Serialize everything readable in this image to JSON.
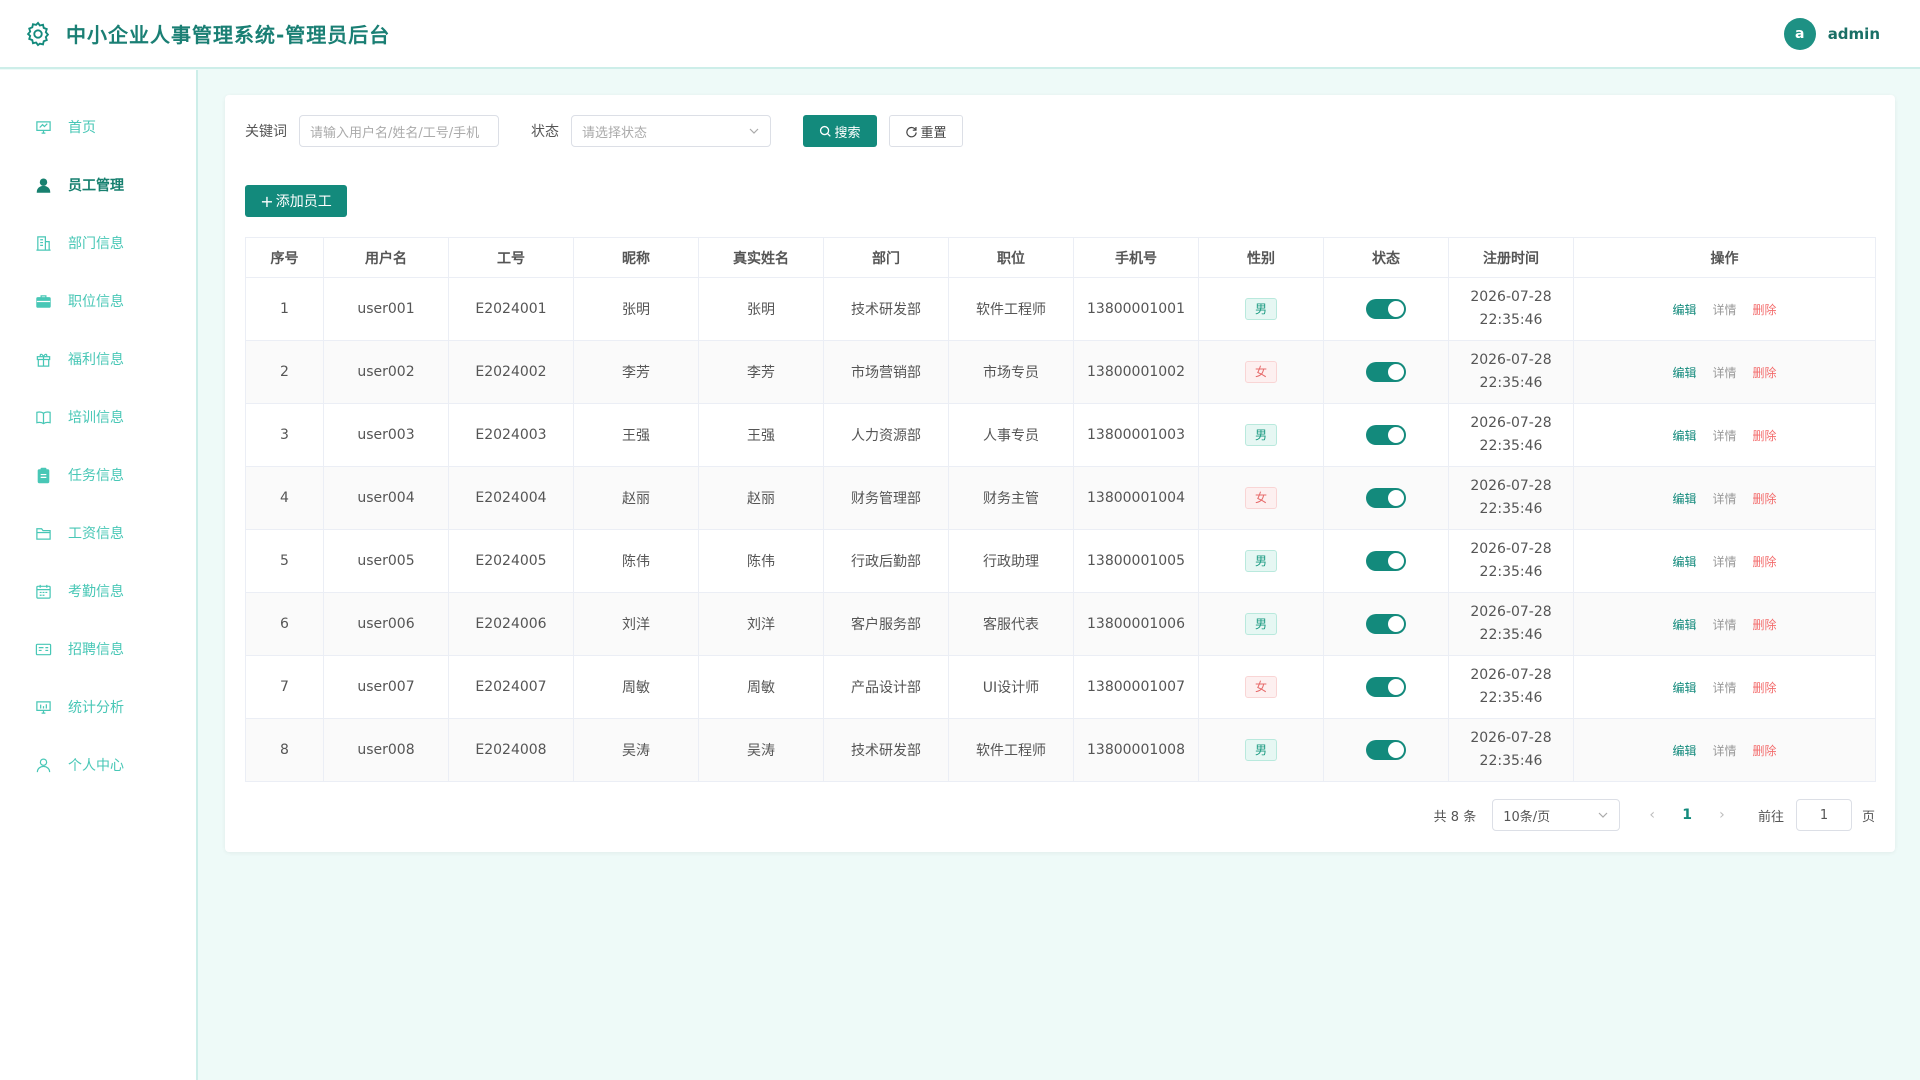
{
  "header": {
    "title": "中小企业人事管理系统-管理员后台",
    "avatar_letter": "a",
    "username": "admin"
  },
  "sidebar": {
    "items": [
      {
        "label": "首页",
        "icon": "dashboard-icon",
        "active": false
      },
      {
        "label": "员工管理",
        "icon": "user-icon",
        "active": true
      },
      {
        "label": "部门信息",
        "icon": "building-icon",
        "active": false
      },
      {
        "label": "职位信息",
        "icon": "briefcase-icon",
        "active": false
      },
      {
        "label": "福利信息",
        "icon": "gift-icon",
        "active": false
      },
      {
        "label": "培训信息",
        "icon": "book-icon",
        "active": false
      },
      {
        "label": "任务信息",
        "icon": "clipboard-icon",
        "active": false
      },
      {
        "label": "工资信息",
        "icon": "folder-icon",
        "active": false
      },
      {
        "label": "考勤信息",
        "icon": "calendar-icon",
        "active": false
      },
      {
        "label": "招聘信息",
        "icon": "id-card-icon",
        "active": false
      },
      {
        "label": "统计分析",
        "icon": "chart-icon",
        "active": false
      },
      {
        "label": "个人中心",
        "icon": "person-icon",
        "active": false
      }
    ]
  },
  "filters": {
    "keyword_label": "关键词",
    "keyword_placeholder": "请输入用户名/姓名/工号/手机",
    "status_label": "状态",
    "status_placeholder": "请选择状态",
    "search_label": "搜索",
    "reset_label": "重置"
  },
  "add_button": "添加员工",
  "table": {
    "columns": [
      "序号",
      "用户名",
      "工号",
      "昵称",
      "真实姓名",
      "部门",
      "职位",
      "手机号",
      "性别",
      "状态",
      "注册时间",
      "操作"
    ],
    "rows": [
      {
        "idx": "1",
        "username": "user001",
        "emp_no": "E2024001",
        "nickname": "张明",
        "realname": "张明",
        "dept": "技术研发部",
        "position": "软件工程师",
        "phone": "13800001001",
        "gender": "男",
        "status_on": true,
        "reg_date": "2026-07-28",
        "reg_time": "22:35:46"
      },
      {
        "idx": "2",
        "username": "user002",
        "emp_no": "E2024002",
        "nickname": "李芳",
        "realname": "李芳",
        "dept": "市场营销部",
        "position": "市场专员",
        "phone": "13800001002",
        "gender": "女",
        "status_on": true,
        "reg_date": "2026-07-28",
        "reg_time": "22:35:46"
      },
      {
        "idx": "3",
        "username": "user003",
        "emp_no": "E2024003",
        "nickname": "王强",
        "realname": "王强",
        "dept": "人力资源部",
        "position": "人事专员",
        "phone": "13800001003",
        "gender": "男",
        "status_on": true,
        "reg_date": "2026-07-28",
        "reg_time": "22:35:46"
      },
      {
        "idx": "4",
        "username": "user004",
        "emp_no": "E2024004",
        "nickname": "赵丽",
        "realname": "赵丽",
        "dept": "财务管理部",
        "position": "财务主管",
        "phone": "13800001004",
        "gender": "女",
        "status_on": true,
        "reg_date": "2026-07-28",
        "reg_time": "22:35:46"
      },
      {
        "idx": "5",
        "username": "user005",
        "emp_no": "E2024005",
        "nickname": "陈伟",
        "realname": "陈伟",
        "dept": "行政后勤部",
        "position": "行政助理",
        "phone": "13800001005",
        "gender": "男",
        "status_on": true,
        "reg_date": "2026-07-28",
        "reg_time": "22:35:46"
      },
      {
        "idx": "6",
        "username": "user006",
        "emp_no": "E2024006",
        "nickname": "刘洋",
        "realname": "刘洋",
        "dept": "客户服务部",
        "position": "客服代表",
        "phone": "13800001006",
        "gender": "男",
        "status_on": true,
        "reg_date": "2026-07-28",
        "reg_time": "22:35:46"
      },
      {
        "idx": "7",
        "username": "user007",
        "emp_no": "E2024007",
        "nickname": "周敏",
        "realname": "周敏",
        "dept": "产品设计部",
        "position": "UI设计师",
        "phone": "13800001007",
        "gender": "女",
        "status_on": true,
        "reg_date": "2026-07-28",
        "reg_time": "22:35:46"
      },
      {
        "idx": "8",
        "username": "user008",
        "emp_no": "E2024008",
        "nickname": "吴涛",
        "realname": "吴涛",
        "dept": "技术研发部",
        "position": "软件工程师",
        "phone": "13800001008",
        "gender": "男",
        "status_on": true,
        "reg_date": "2026-07-28",
        "reg_time": "22:35:46"
      }
    ],
    "actions": {
      "edit": "编辑",
      "detail": "详情",
      "delete": "删除"
    }
  },
  "pagination": {
    "total_text": "共 8 条",
    "page_size": "10条/页",
    "current_page": "1",
    "goto_label": "前往",
    "goto_value": "1",
    "page_suffix": "页"
  },
  "colors": {
    "primary": "#138a7c",
    "sidebar_text": "#48c7b6",
    "background": "#eefaf8",
    "male_tag": "#1a9a80",
    "female_tag": "#e66a6a",
    "delete": "#f36c6c"
  }
}
